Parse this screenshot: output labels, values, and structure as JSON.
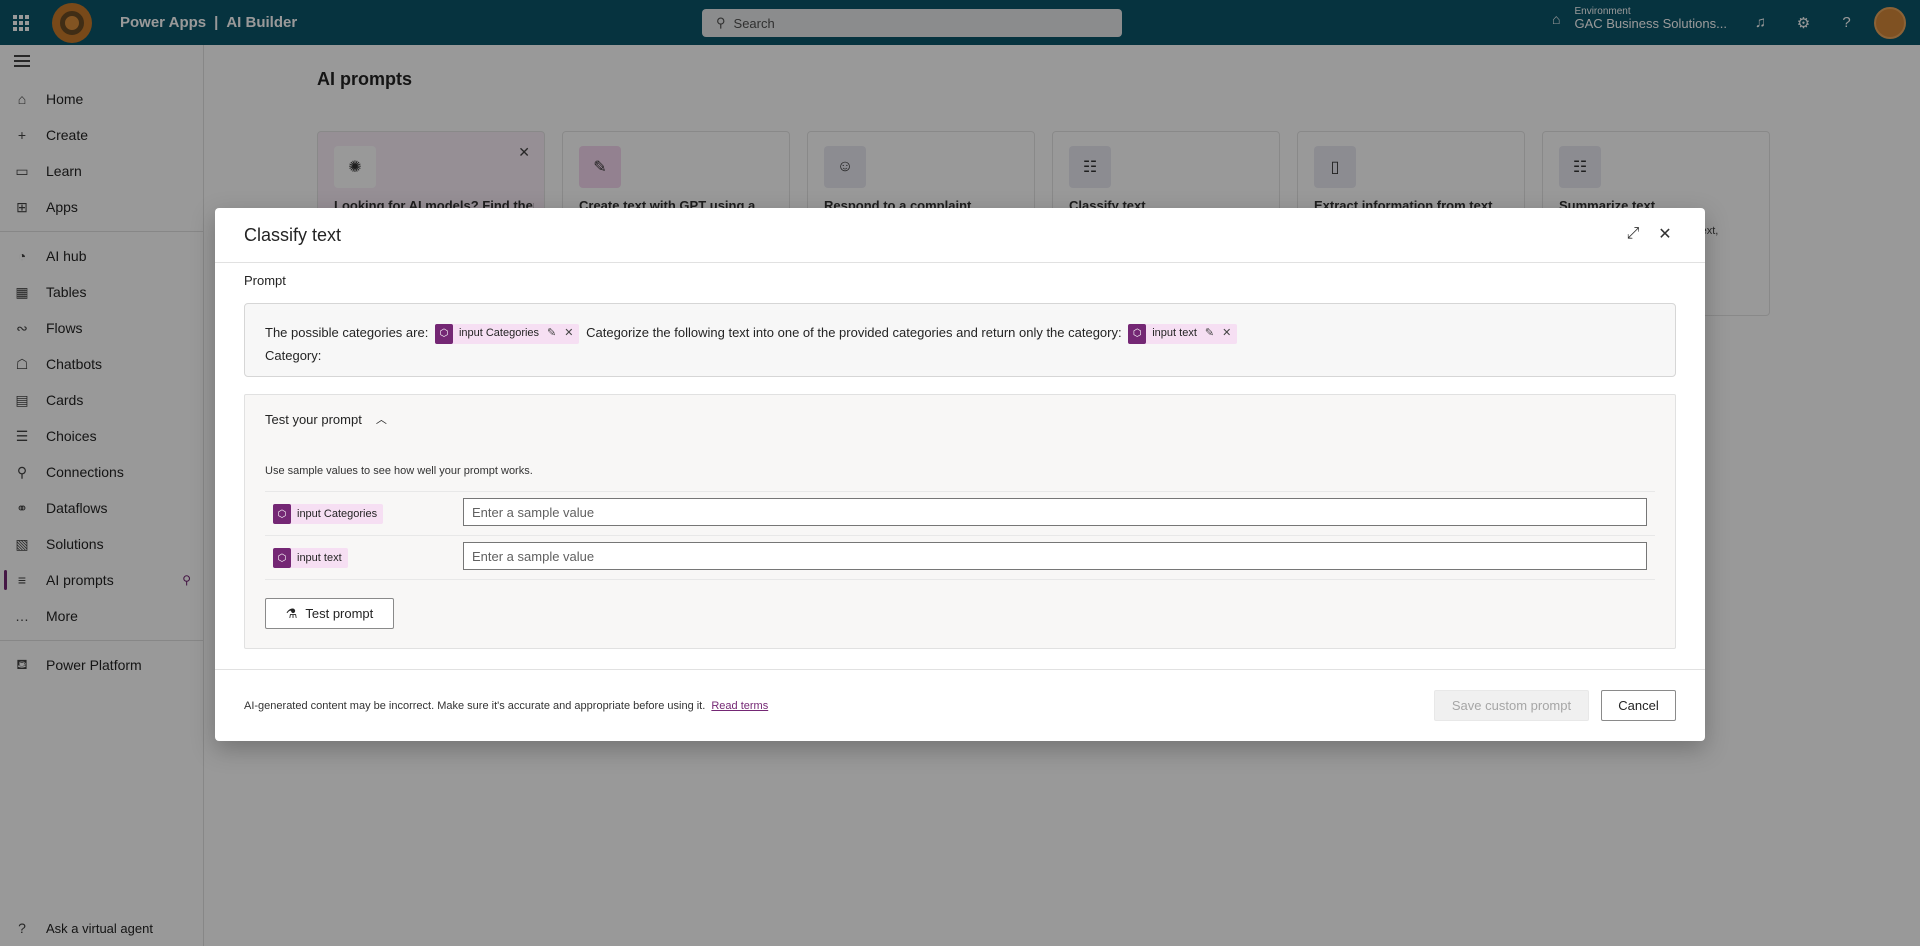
{
  "topbar": {
    "app_name": "Power Apps",
    "separator": "|",
    "product": "AI Builder",
    "search_placeholder": "Search",
    "env_label": "Environment",
    "env_name": "GAC Business Solutions..."
  },
  "sidebar": {
    "items": [
      {
        "label": "Home",
        "icon": "home-icon",
        "glyph": "⌂"
      },
      {
        "label": "Create",
        "icon": "plus-icon",
        "glyph": "+"
      },
      {
        "label": "Learn",
        "icon": "book-icon",
        "glyph": "▭"
      },
      {
        "label": "Apps",
        "icon": "apps-icon",
        "glyph": "⊞"
      },
      {
        "label": "AI hub",
        "icon": "ai-hub-icon",
        "glyph": "◔"
      },
      {
        "label": "Tables",
        "icon": "table-icon",
        "glyph": "▦"
      },
      {
        "label": "Flows",
        "icon": "flow-icon",
        "glyph": "∾"
      },
      {
        "label": "Chatbots",
        "icon": "chatbot-icon",
        "glyph": "☖"
      },
      {
        "label": "Cards",
        "icon": "card-icon",
        "glyph": "▤"
      },
      {
        "label": "Choices",
        "icon": "choices-icon",
        "glyph": "☰"
      },
      {
        "label": "Connections",
        "icon": "connection-icon",
        "glyph": "⚲"
      },
      {
        "label": "Dataflows",
        "icon": "dataflow-icon",
        "glyph": "⚭"
      },
      {
        "label": "Solutions",
        "icon": "solutions-icon",
        "glyph": "▧"
      },
      {
        "label": "AI prompts",
        "icon": "ai-prompts-icon",
        "glyph": "≡"
      },
      {
        "label": "More",
        "icon": "more-icon",
        "glyph": "…"
      },
      {
        "label": "Power Platform",
        "icon": "power-platform-icon",
        "glyph": "⛾"
      }
    ],
    "ask": "Ask a virtual agent"
  },
  "main": {
    "title": "AI prompts",
    "cards": [
      {
        "title": "Looking for AI models? Find them",
        "icon": "brain-icon",
        "glyph": "✺"
      },
      {
        "title": "Create text with GPT using a",
        "icon": "text-edit-icon",
        "glyph": "✎"
      },
      {
        "title": "Respond to a complaint",
        "icon": "person-chat-icon",
        "glyph": "☺"
      },
      {
        "title": "Classify text",
        "icon": "classify-icon",
        "glyph": "☷"
      },
      {
        "title": "Extract information from text",
        "icon": "document-icon",
        "glyph": "▯"
      },
      {
        "title": "Summarize text",
        "icon": "summarize-icon",
        "glyph": "☷"
      }
    ],
    "card_desc": "y text,",
    "bg_button": "mpts"
  },
  "dialog": {
    "title": "Classify text",
    "prompt_label": "Prompt",
    "prompt_part1": "The possible categories are:",
    "chip1": "input Categories",
    "prompt_part2": "Categorize the following text into one of the provided categories and return only the category:",
    "chip2": "input text",
    "prompt_line2": "Category:",
    "test_heading": "Test your prompt",
    "test_hint": "Use sample values to see how well your prompt works.",
    "rows": [
      {
        "chip": "input Categories",
        "placeholder": "Enter a sample value"
      },
      {
        "chip": "input text",
        "placeholder": "Enter a sample value"
      }
    ],
    "test_button": "Test prompt",
    "disclaimer": "AI-generated content may be incorrect. Make sure it's accurate and appropriate before using it.",
    "read_terms": "Read terms",
    "save_button": "Save custom prompt",
    "cancel_button": "Cancel"
  }
}
